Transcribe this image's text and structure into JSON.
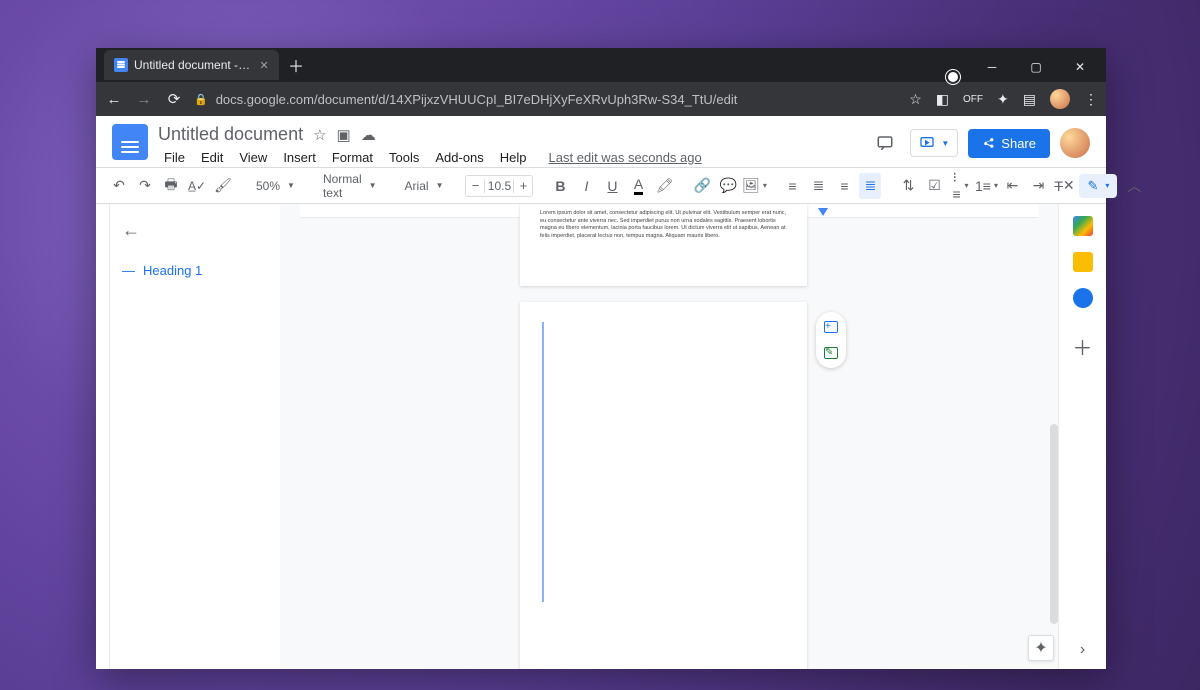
{
  "browser": {
    "tab_title": "Untitled document - Google Doc",
    "url": "docs.google.com/document/d/14XPijxzVHUUCpI_BI7eDHjXyFeXRvUph3Rw-S34_TtU/edit"
  },
  "header": {
    "doc_title": "Untitled document",
    "last_edit": "Last edit was seconds ago",
    "share_label": "Share",
    "menus": [
      "File",
      "Edit",
      "View",
      "Insert",
      "Format",
      "Tools",
      "Add-ons",
      "Help"
    ]
  },
  "toolbar": {
    "zoom": "50%",
    "style": "Normal text",
    "font": "Arial",
    "font_size": "10.5"
  },
  "outline": {
    "items": [
      {
        "label": "Heading 1"
      }
    ]
  },
  "page1_text": "Lorem ipsum dolor sit amet, consectetur adipiscing elit. Ut pulvinar elit. Vestibulum semper erat nunc, eu consectetur ante viverra nec. Sed imperdiet purus non urna sodales sagittis. Praesent lobortis magna eu libero elementum, lacinia porta faucibus lorem. Ut dictum viverra elit ut sapibus. Aenean at felis imperdiet, placerat lectus non, tempus magna. Aliquam mauris libero."
}
